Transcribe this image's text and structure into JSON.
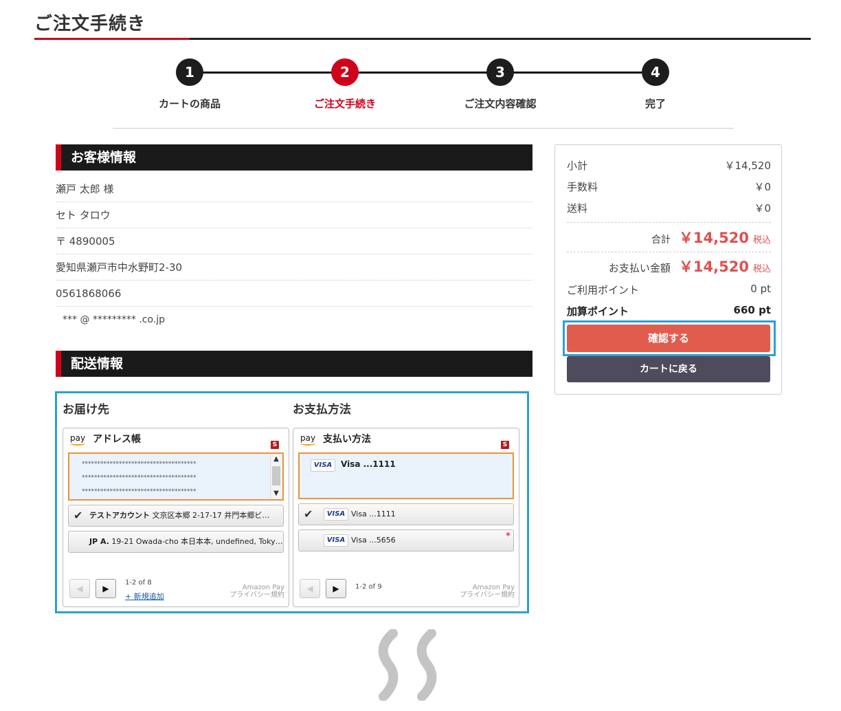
{
  "page_title": "ご注文手続き",
  "steps": [
    {
      "num": "1",
      "label": "カートの商品"
    },
    {
      "num": "2",
      "label": "ご注文手続き"
    },
    {
      "num": "3",
      "label": "ご注文内容確認"
    },
    {
      "num": "4",
      "label": "完了"
    }
  ],
  "customer": {
    "header": "お客様情報",
    "name": "瀬戸 太郎 様",
    "kana": "セト タロウ",
    "postal": "〒 4890005",
    "address": "愛知県瀬戸市中水野町2-30",
    "phone": "0561868066",
    "email": "*** @ ********* .co.jp"
  },
  "shipping": {
    "header": "配送情報",
    "dest_title": "お届け先",
    "pay_title": "お支払方法"
  },
  "address_widget": {
    "logo": "pay",
    "title": "アドレス帳",
    "badge": "S",
    "masked": [
      "*************************************",
      "*************************************",
      "*************************************"
    ],
    "options": [
      {
        "bold": "テストアカウント",
        "rest": " 文京区本郷 2-17-17 井門本郷ビ…"
      },
      {
        "bold": "JP A.",
        "rest": " 19-21 Owada-cho 本日本本, undefined, Toky…"
      }
    ],
    "count": "1-2 of 8",
    "add_label": "+ 新規追加",
    "brand_1": "Amazon Pay",
    "brand_2": "プライバシー規約"
  },
  "payment_widget": {
    "logo": "pay",
    "title": "支払い方法",
    "badge": "S",
    "selected": {
      "brand": "VISA",
      "label": "Visa ...1111"
    },
    "options": [
      {
        "brand": "VISA",
        "label": "Visa ...1111"
      },
      {
        "brand": "VISA",
        "label": "Visa ...5656",
        "star": "*"
      }
    ],
    "count": "1-2 of 9",
    "brand_1": "Amazon Pay",
    "brand_2": "プライバシー規約"
  },
  "summary": {
    "subtotal_label": "小計",
    "subtotal": "￥14,520",
    "fee_label": "手数料",
    "fee": "￥0",
    "shipping_label": "送料",
    "shipping": "￥0",
    "total_label": "合計",
    "total": "￥14,520",
    "tax_label": "税込",
    "payment_label": "お支払い金額",
    "payment": "￥14,520",
    "used_points_label": "ご利用ポイント",
    "used_points": "0 pt",
    "added_points_label": "加算ポイント",
    "added_points": "660 pt",
    "confirm_label": "確認する",
    "back_label": "カートに戻る"
  },
  "colors": {
    "brand_red": "#d0021b",
    "confirm_button": "#e05d4e",
    "back_button": "#4d4b5c",
    "highlight_blue": "#2aa0d8",
    "selection_orange": "#e8943a",
    "price_red": "#e04f4f"
  }
}
